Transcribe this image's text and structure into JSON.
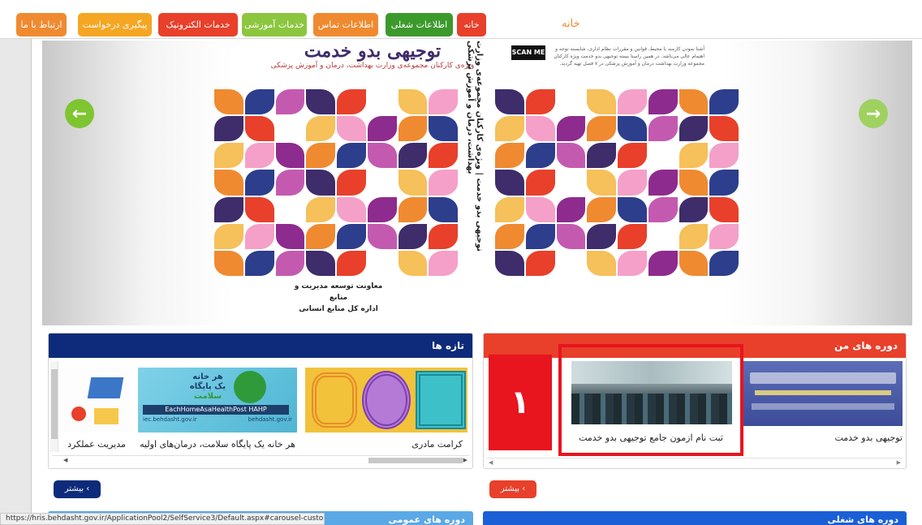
{
  "nav": {
    "items": [
      {
        "label": "خانه",
        "color": "#e8402a"
      },
      {
        "label": "اطلاعات شغلی",
        "color": "#3c9a2c"
      },
      {
        "label": "اطلاعات تماس",
        "color": "#f08a30"
      },
      {
        "label": "خدمات آموزشی",
        "color": "#8cc63f"
      },
      {
        "label": "خدمات الکترونیک",
        "color": "#e8402a"
      },
      {
        "label": "پیگیری درخواست",
        "color": "#f5a623"
      },
      {
        "label": "ارتباط با ما",
        "color": "#f08a30"
      }
    ],
    "breadcrumb": "خانه"
  },
  "carousel": {
    "cover_title": "توجیهی بدو خدمت",
    "cover_subtitle": "ویژه‌ی کارکنان مجموعه‌ی وزارت بهداشت، درمان و آموزش پزشکی",
    "spine_text": "توجیهی بدو خدمت | ویژه‌ی کارکنان مجموعه‌ی وزارت بهداشت، درمان و آموزش پزشکی",
    "publisher_line1": "معاونت توسعه مدیریت و منابع",
    "publisher_line2": "اداره کل منابع انسانی",
    "scan_label": "SCAN ME",
    "back_text": "آشنا نمودن کارمند با محیط، قوانین و مقررات نظام اداری، شایسته توجه و اهتمام عالی می‌باشد. در همین راستا بسته توجیهی بدو خدمت ویژه کارکنان مجموعه وزارت بهداشت درمان و آموزش پزشکی در ۷ فصل تهیه گردید."
  },
  "panels": {
    "my_courses": {
      "title": "دوره های من",
      "header_color": "#e8402a",
      "cards": [
        {
          "label": "توجیهی بدو خدمت",
          "image": "calligraphy-banner"
        },
        {
          "label": "ثبت نام ازمون جامع توجیهی بدو خدمت",
          "image": "exam-hall-photo"
        }
      ],
      "highlight_number": "۱",
      "highlight_color": "#e8141e",
      "more_label": "بیشتر",
      "more_color": "#e8402a"
    },
    "news": {
      "title": "تازه ها",
      "header_color": "#0d2b7a",
      "cards": [
        {
          "label": "کرامت مادری",
          "image": "maze-pattern"
        },
        {
          "label": "هر خانه یک پایگاه سلامت، درمان‌های اولیه",
          "image": "health-post-banner"
        },
        {
          "label": "مدیریت عملکرد",
          "image": "graduation-cap-icon"
        }
      ],
      "banner_line1": "هر خانه",
      "banner_line2": "یک پایگاه",
      "banner_line3": "سلامت",
      "banner_english": "EachHomeAsaHealthPost HAHP",
      "banner_site1": "iec.behdasht.gov.ir",
      "banner_site2": "behdasht.gov.ir",
      "more_label": "بیشتر",
      "more_color": "#0d2b7a"
    },
    "bottom_right": {
      "title": "دوره های شغلی",
      "header_color": "#1a5fd6"
    },
    "bottom_left": {
      "title": "دوره های عمومی",
      "header_color": "#5aa8e6"
    }
  },
  "status_url": "https://hris.behdasht.gov.ir/ApplicationPool2/SelfService3/Default.aspx#carousel-custo..."
}
